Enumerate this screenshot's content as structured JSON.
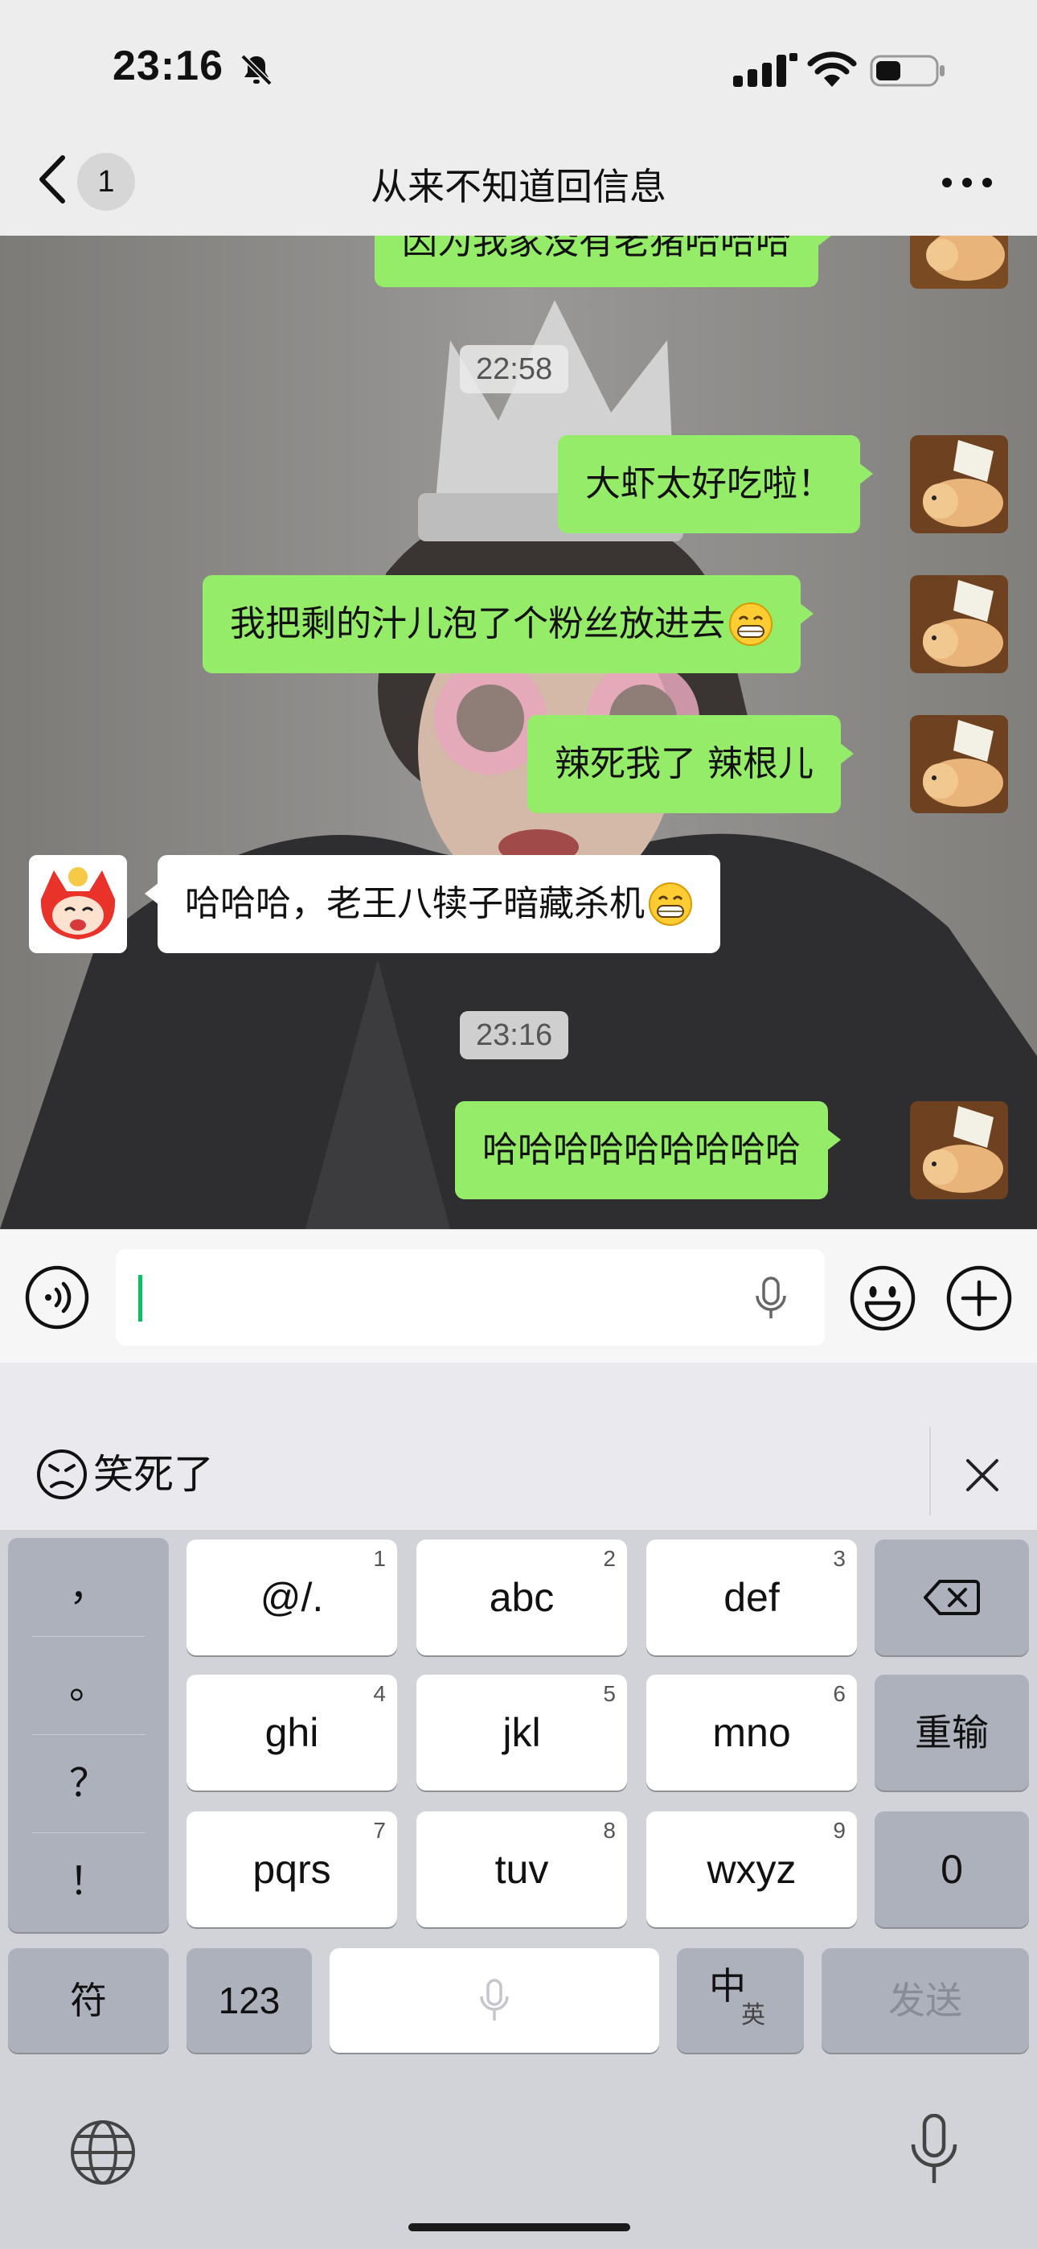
{
  "status_bar": {
    "time": "23:16",
    "icons": [
      "bell-off-icon",
      "cellular-signal-icon",
      "wifi-icon",
      "battery-icon"
    ]
  },
  "nav": {
    "back_badge": "1",
    "title": "从来不知道回信息",
    "more_icon": "more-icon"
  },
  "messages": [
    {
      "from": "me",
      "text": "因为我家没有老猪哈哈哈",
      "partially_hidden": true
    },
    {
      "type": "timestamp",
      "text": "22:58"
    },
    {
      "from": "me",
      "text": "大虾太好吃啦！"
    },
    {
      "from": "me",
      "text": "我把剩的汁儿泡了个粉丝放进去",
      "emoji": "grin-emoji"
    },
    {
      "from": "me",
      "text": "辣死我了 辣根儿"
    },
    {
      "from": "other",
      "text": "哈哈哈，老王八犊子暗藏杀机",
      "emoji": "grin-emoji"
    },
    {
      "type": "timestamp",
      "text": "23:16"
    },
    {
      "from": "me",
      "text": "哈哈哈哈哈哈哈哈哈"
    }
  ],
  "input": {
    "value": "",
    "icons": [
      "voice-icon",
      "mic-icon",
      "emoji-icon",
      "plus-icon"
    ]
  },
  "keyboard": {
    "suggestion": "笑死了",
    "punctuation": [
      "，",
      "。",
      "？",
      "！"
    ],
    "keys": [
      {
        "label": "@/.",
        "num": "1"
      },
      {
        "label": "abc",
        "num": "2"
      },
      {
        "label": "def",
        "num": "3"
      },
      {
        "label": "ghi",
        "num": "4"
      },
      {
        "label": "jkl",
        "num": "5"
      },
      {
        "label": "mno",
        "num": "6"
      },
      {
        "label": "pqrs",
        "num": "7"
      },
      {
        "label": "tuv",
        "num": "8"
      },
      {
        "label": "wxyz",
        "num": "9"
      }
    ],
    "retype": "重输",
    "zero": "0",
    "symbols": "符",
    "numbers": "123",
    "lang_main": "中",
    "lang_alt": "英",
    "send": "发送"
  },
  "colors": {
    "my_bubble": "#95ec69",
    "other_bubble": "#ffffff",
    "cursor": "#07c160"
  }
}
